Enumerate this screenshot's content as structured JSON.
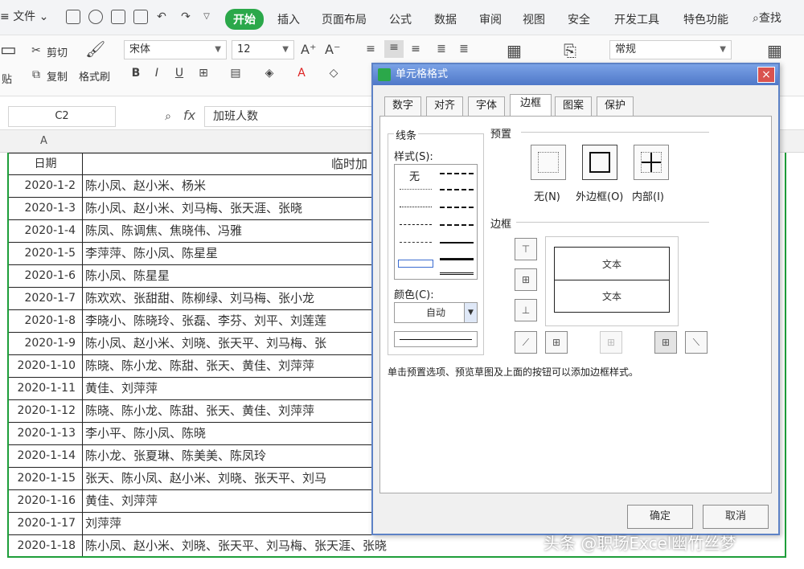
{
  "menubar": {
    "file": "文件",
    "tabs": [
      "开始",
      "插入",
      "页面布局",
      "公式",
      "数据",
      "审阅",
      "视图",
      "安全",
      "开发工具",
      "特色功能"
    ],
    "search": "查找"
  },
  "ribbon": {
    "cut": "剪切",
    "copy": "复制",
    "paste": "贴",
    "format_painter": "格式刷",
    "font_name": "宋体",
    "font_size": "12",
    "number_format": "常规"
  },
  "formula_bar": {
    "name_box": "C2",
    "fx": "fx",
    "formula": "加班人数"
  },
  "sheet": {
    "col_a": "A",
    "header": {
      "date": "日期",
      "names": "临时加"
    },
    "rows": [
      {
        "date": "2020-1-2",
        "names": "陈小凤、赵小米、杨米"
      },
      {
        "date": "2020-1-3",
        "names": "陈小凤、赵小米、刘马梅、张天涯、张晓"
      },
      {
        "date": "2020-1-4",
        "names": "陈凤、陈调焦、焦晓伟、冯雅"
      },
      {
        "date": "2020-1-5",
        "names": "李萍萍、陈小凤、陈星星"
      },
      {
        "date": "2020-1-6",
        "names": "陈小凤、陈星星"
      },
      {
        "date": "2020-1-7",
        "names": "陈欢欢、张甜甜、陈柳绿、刘马梅、张小龙"
      },
      {
        "date": "2020-1-8",
        "names": "李晓小、陈晓玲、张磊、李芬、刘平、刘莲莲"
      },
      {
        "date": "2020-1-9",
        "names": "陈小凤、赵小米、刘晓、张天平、刘马梅、张"
      },
      {
        "date": "2020-1-10",
        "names": "陈晓、陈小龙、陈甜、张天、黄佳、刘萍萍"
      },
      {
        "date": "2020-1-11",
        "names": "黄佳、刘萍萍"
      },
      {
        "date": "2020-1-12",
        "names": "陈晓、陈小龙、陈甜、张天、黄佳、刘萍萍"
      },
      {
        "date": "2020-1-13",
        "names": "李小平、陈小凤、陈晓"
      },
      {
        "date": "2020-1-14",
        "names": "陈小龙、张夏琳、陈美美、陈凤玲"
      },
      {
        "date": "2020-1-15",
        "names": "张天、陈小凤、赵小米、刘晓、张天平、刘马"
      },
      {
        "date": "2020-1-16",
        "names": "黄佳、刘萍萍"
      },
      {
        "date": "2020-1-17",
        "names": "刘萍萍"
      },
      {
        "date": "2020-1-18",
        "names": "陈小凤、赵小米、刘晓、张天平、刘马梅、张天涯、张晓"
      }
    ]
  },
  "dialog": {
    "title": "单元格格式",
    "close": "×",
    "tabs": [
      "数字",
      "对齐",
      "字体",
      "边框",
      "图案",
      "保护"
    ],
    "active_tab": "边框",
    "line_group": "线条",
    "style_label": "样式(S):",
    "style_none": "无",
    "color_label": "颜色(C):",
    "color_value": "自动",
    "preset_label": "预置",
    "presets": [
      "无(N)",
      "外边框(O)",
      "内部(I)"
    ],
    "border_label": "边框",
    "preview_text_top": "文本",
    "preview_text_bottom": "文本",
    "hint": "单击预置选项、预览草图及上面的按钮可以添加边框样式。",
    "ok": "确定",
    "cancel": "取消"
  },
  "watermark": "头条 @职场Excel幽竹丝梦"
}
